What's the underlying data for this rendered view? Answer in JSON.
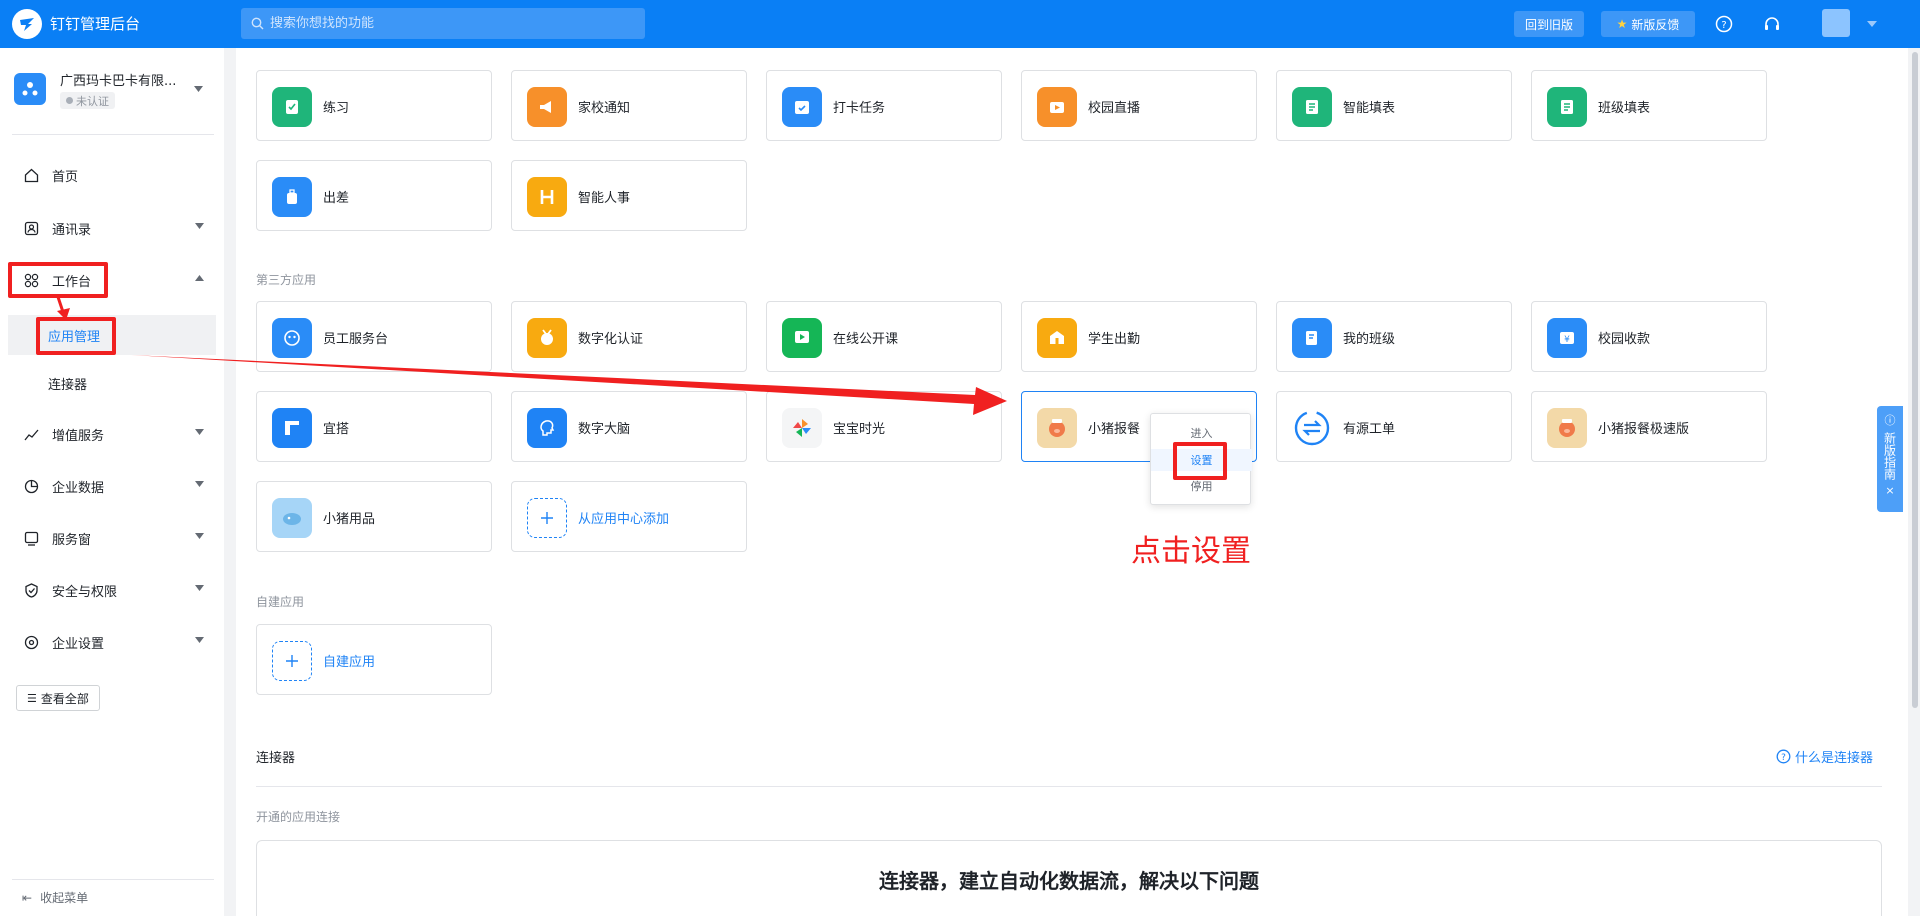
{
  "topbar": {
    "brand": "钉钉管理后台",
    "search_placeholder": "搜索你想找的功能",
    "old_version": "回到旧版",
    "feedback": "新版反馈"
  },
  "sidebar": {
    "org_name": "广西玛卡巴卡有限...",
    "org_status": "未认证",
    "items": [
      {
        "label": "首页",
        "icon": "home-icon"
      },
      {
        "label": "通讯录",
        "icon": "contacts-icon"
      },
      {
        "label": "工作台",
        "icon": "grid-icon"
      },
      {
        "label": "增值服务",
        "icon": "chart-icon"
      },
      {
        "label": "企业数据",
        "icon": "data-icon"
      },
      {
        "label": "服务窗",
        "icon": "service-icon"
      },
      {
        "label": "安全与权限",
        "icon": "shield-icon"
      },
      {
        "label": "企业设置",
        "icon": "settings-icon"
      }
    ],
    "sub_items": [
      "应用管理",
      "连接器"
    ],
    "view_all": "查看全部",
    "collapse": "收起菜单"
  },
  "main": {
    "row1": [
      {
        "name": "练习",
        "color": "#1fb57a"
      },
      {
        "name": "家校通知",
        "color": "#f7902a"
      },
      {
        "name": "打卡任务",
        "color": "#2a8cf7"
      },
      {
        "name": "校园直播",
        "color": "#f7902a"
      },
      {
        "name": "智能填表",
        "color": "#1fb57a"
      },
      {
        "name": "班级填表",
        "color": "#1fb57a"
      }
    ],
    "row2": [
      {
        "name": "出差",
        "color": "#2a8cf7"
      },
      {
        "name": "智能人事",
        "color": "#f8aa10"
      }
    ],
    "third_party_title": "第三方应用",
    "third_row1": [
      {
        "name": "员工服务台",
        "color": "#2a8cf7"
      },
      {
        "name": "数字化认证",
        "color": "#f8aa10"
      },
      {
        "name": "在线公开课",
        "color": "#15b656"
      },
      {
        "name": "学生出勤",
        "color": "#f8aa10"
      },
      {
        "name": "我的班级",
        "color": "#2a8cf7"
      },
      {
        "name": "校园收款",
        "color": "#2a8cf7"
      }
    ],
    "third_row2": [
      {
        "name": "宜搭",
        "color": "#1f83f5"
      },
      {
        "name": "数字大脑",
        "color": "#1f83f5"
      },
      {
        "name": "宝宝时光",
        "color": "#ffffff"
      },
      {
        "name": "小猪报餐",
        "color": "#f3d9a8"
      },
      {
        "name": "有源工单",
        "color": "#ffffff"
      },
      {
        "name": "小猪报餐极速版",
        "color": "#f3d9a8"
      }
    ],
    "third_row3": [
      {
        "name": "小猪用品",
        "color": "#a6d5f7"
      }
    ],
    "add_from_center": "从应用中心添加",
    "self_built_title": "自建应用",
    "self_built": "自建应用",
    "dropdown": [
      "进入",
      "设置",
      "停用"
    ],
    "annotation": "点击设置",
    "connector_title": "连接器",
    "connector_help": "什么是连接器",
    "connector_sub": "开通的应用连接",
    "connector_banner": "连接器，建立自动化数据流，解决以下问题",
    "guide": "新版指南"
  }
}
